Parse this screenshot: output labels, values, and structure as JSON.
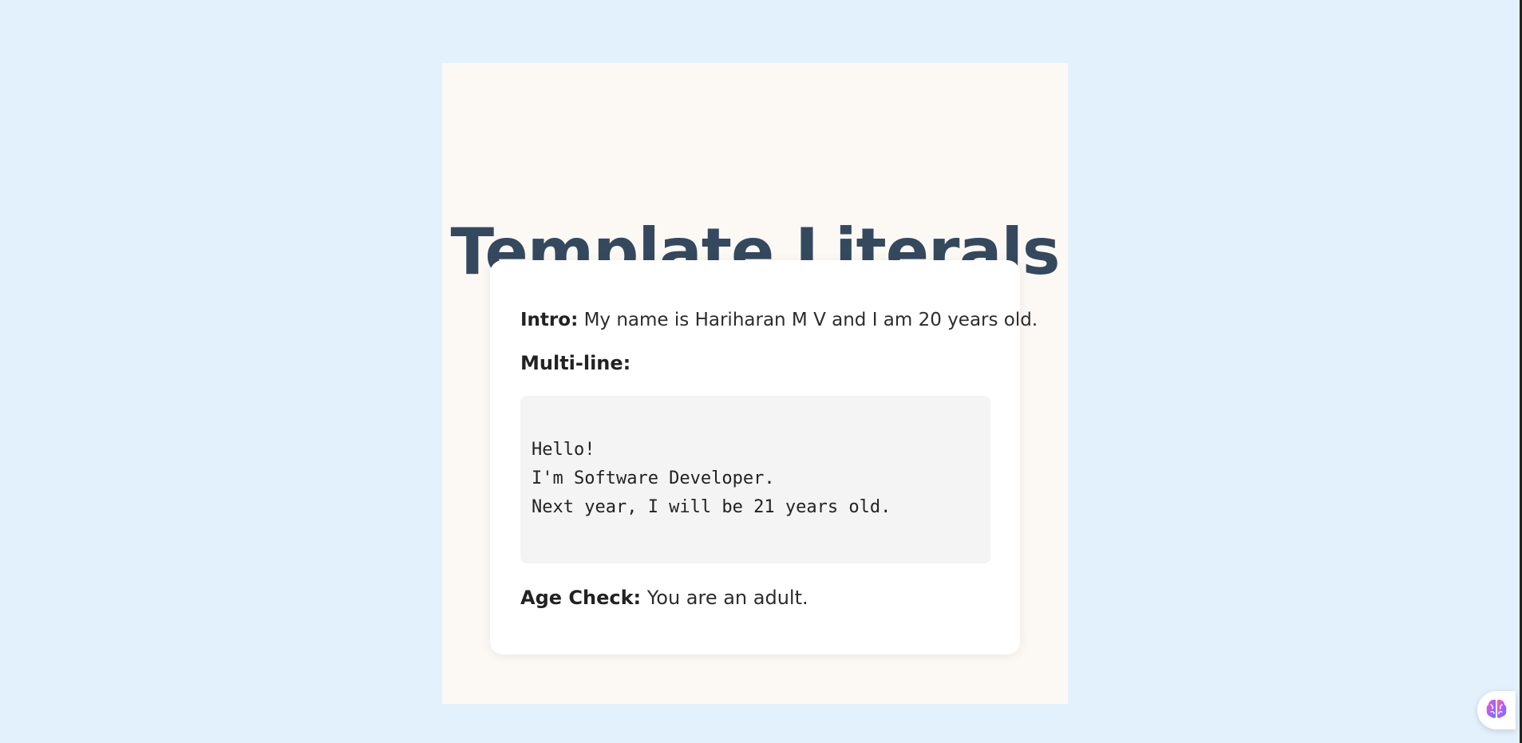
{
  "main": {
    "title": "Template Literals",
    "intro_label": "Intro:",
    "intro_text": " My name is Hariharan M V and I am 20 years old.",
    "multiline_label": "Multi-line:",
    "multiline_lines": [
      "Hello!",
      "I'm Software Developer.",
      "Next year, I will be 21 years old."
    ],
    "age_label": "Age Check:",
    "age_text": " You are an adult."
  },
  "widget": {
    "icon": "brain-icon"
  },
  "colors": {
    "background": "#e3f1fc",
    "panel": "#fcf9f5",
    "title": "#34495e",
    "card": "#ffffff",
    "code_bg": "#f4f4f4"
  }
}
